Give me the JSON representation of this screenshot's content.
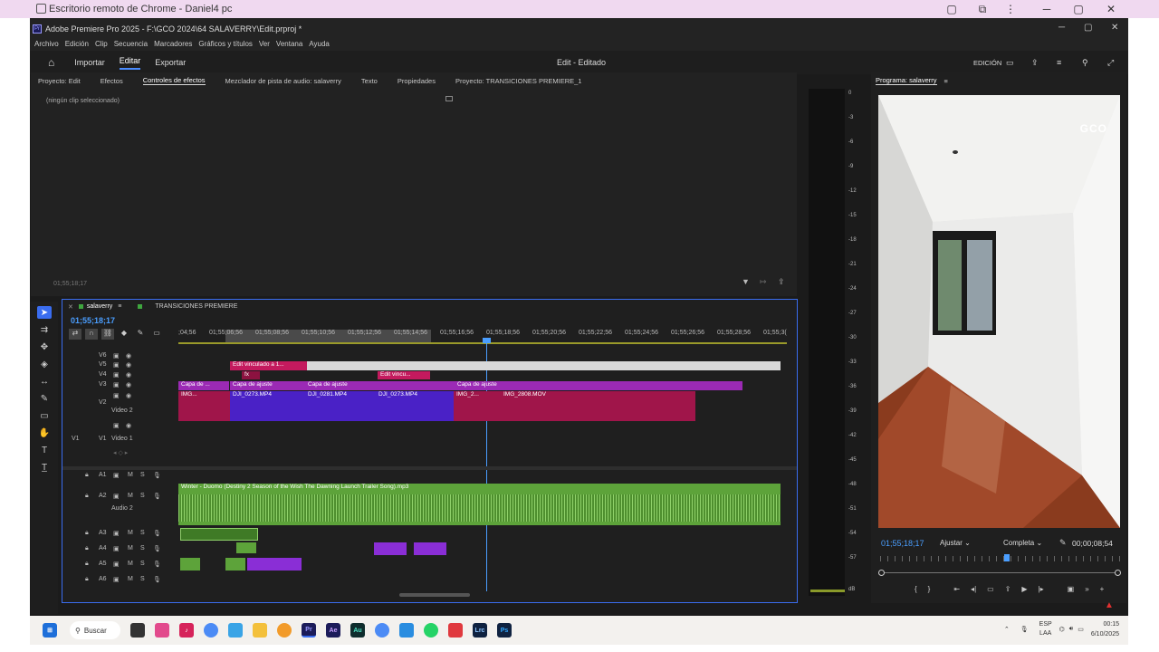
{
  "chrome": {
    "title": "Escritorio remoto de Chrome - Daniel4 pc"
  },
  "app": {
    "title": "Adobe Premiere Pro 2025 - F:\\GCO 2024\\64 SALAVERRY\\Edit.prproj *",
    "menu": [
      "Archivo",
      "Edición",
      "Clip",
      "Secuencia",
      "Marcadores",
      "Gráficos y títulos",
      "Ver",
      "Ventana",
      "Ayuda"
    ],
    "nav": {
      "import": "Importar",
      "edit": "Editar",
      "export": "Exportar",
      "center": "Edit - Editado",
      "workspace": "EDICIÓN"
    }
  },
  "source_panel": {
    "tabs": [
      "Proyecto: Edit",
      "Efectos",
      "Controles de efectos",
      "Mezclador de pista de audio: salaverry",
      "Texto",
      "Propiedades",
      "Proyecto: TRANSICIONES PREMIERE_1"
    ],
    "empty_text": "(ningún clip seleccionado)",
    "timecode": "01;55;18;17"
  },
  "timeline": {
    "tabs": [
      "salaverry",
      "TRANSICIONES PREMIERE"
    ],
    "timecode": "01;55;18;17",
    "ruler": [
      ";04;56",
      "01;55;06;56",
      "01;55;08;56",
      "01;55;10;56",
      "01;55;12;56",
      "01;55;14;56",
      "01;55;16;56",
      "01;55;18;56",
      "01;55;20;56",
      "01;55;22;56",
      "01;55;24;56",
      "01;55;26;56",
      "01;55;28;56",
      "01;55;3("
    ],
    "video_tracks": [
      {
        "id": "V6"
      },
      {
        "id": "V5"
      },
      {
        "id": "V4"
      },
      {
        "id": "V3"
      },
      {
        "id": "V2",
        "name": "Video 2"
      },
      {
        "id": "V1",
        "name": "Video 1",
        "src": "V1"
      }
    ],
    "audio_tracks": [
      {
        "id": "A1"
      },
      {
        "id": "A2",
        "name": "Audio 2"
      },
      {
        "id": "A3"
      },
      {
        "id": "A4"
      },
      {
        "id": "A5"
      },
      {
        "id": "A6"
      }
    ],
    "track_btn_m": "M",
    "track_btn_s": "S",
    "clips": {
      "v5_a": "Edit vinculado a 1...",
      "v4_a": "Edit vincu...",
      "fx": "fx",
      "v3_a": "Capa de ...",
      "v3_b": "Capa de ajuste",
      "v3_c": "Capa de ajuste",
      "v3_d": "Capa de ajuste",
      "v2_a": "IMG...",
      "v2_b": "DJI_0273.MP4",
      "v2_c": "DJI_0281.MP4",
      "v2_d": "DJI_0273.MP4",
      "v2_e": "IMG_2...",
      "v2_f": "IMG_2808.MOV",
      "audio_main": "Winter - Duomo (Destiny 2 Season of the Wish The Dawning Launch Trailer Song).mp3"
    }
  },
  "meter": {
    "labels": [
      "0",
      "-3",
      "-6",
      "-9",
      "-12",
      "-15",
      "-18",
      "-21",
      "-24",
      "-27",
      "-30",
      "-33",
      "-36",
      "-39",
      "-42",
      "-45",
      "-48",
      "-51",
      "-54",
      "-57",
      "dB"
    ]
  },
  "program": {
    "title": "Programa: salaverry",
    "watermark": "GCO",
    "timecode": "01;55;18;17",
    "fit": "Ajustar",
    "quality": "Completa",
    "duration": "00;00;08;54"
  },
  "taskbar": {
    "search": "Buscar",
    "lang1": "ESP",
    "lang2": "LAA",
    "time": "00:15",
    "date": "6/10/2025"
  }
}
